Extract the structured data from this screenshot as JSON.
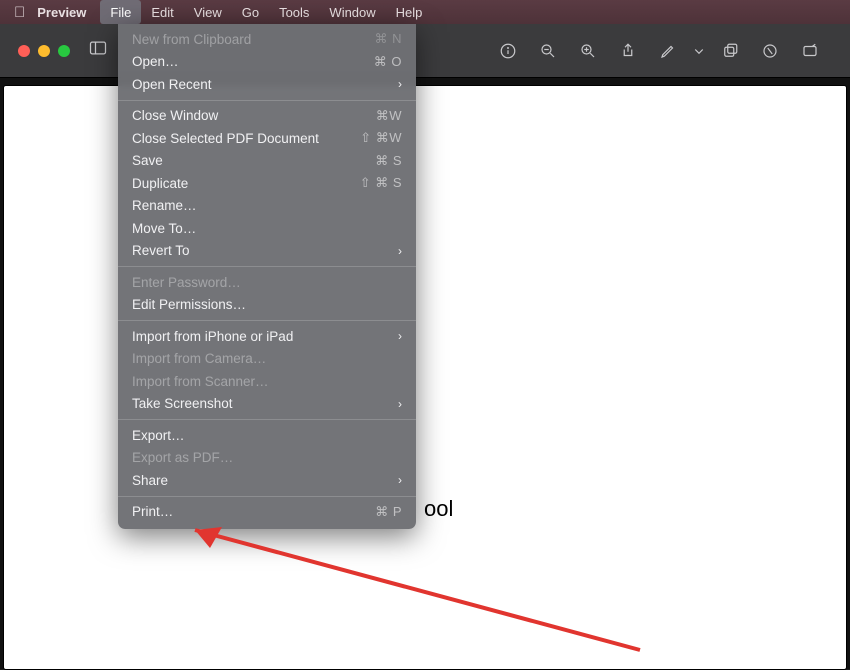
{
  "menubar": {
    "appname": "Preview",
    "items": [
      "File",
      "Edit",
      "View",
      "Go",
      "Tools",
      "Window",
      "Help"
    ],
    "open_index": 0
  },
  "file_menu": [
    {
      "label": "New from Clipboard",
      "shortcut": "⌘ N",
      "disabled": true
    },
    {
      "label": "Open…",
      "shortcut": "⌘ O"
    },
    {
      "label": "Open Recent",
      "submenu": true
    },
    {
      "sep": true
    },
    {
      "label": "Close Window",
      "shortcut": "⌘W"
    },
    {
      "label": "Close Selected PDF Document",
      "shortcut": "⇧ ⌘W"
    },
    {
      "label": "Save",
      "shortcut": "⌘ S"
    },
    {
      "label": "Duplicate",
      "shortcut": "⇧ ⌘ S"
    },
    {
      "label": "Rename…"
    },
    {
      "label": "Move To…"
    },
    {
      "label": "Revert To",
      "submenu": true
    },
    {
      "sep": true
    },
    {
      "label": "Enter Password…",
      "disabled": true
    },
    {
      "label": "Edit Permissions…"
    },
    {
      "sep": true
    },
    {
      "label": "Import from iPhone or iPad",
      "submenu": true
    },
    {
      "label": "Import from Camera…",
      "disabled": true
    },
    {
      "label": "Import from Scanner…",
      "disabled": true
    },
    {
      "label": "Take Screenshot",
      "submenu": true
    },
    {
      "sep": true
    },
    {
      "label": "Export…"
    },
    {
      "label": "Export as PDF…",
      "disabled": true
    },
    {
      "label": "Share",
      "submenu": true
    },
    {
      "sep": true
    },
    {
      "label": "Print…",
      "shortcut": "⌘ P"
    }
  ],
  "document": {
    "visible_text": "ool"
  },
  "toolbar_icons": [
    "info",
    "zoom-out",
    "zoom-in",
    "share",
    "markup",
    "more",
    "rotate",
    "search",
    "edit"
  ]
}
